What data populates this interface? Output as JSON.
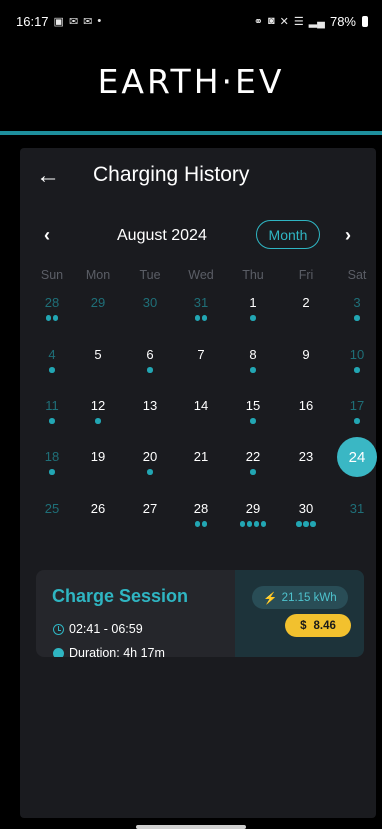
{
  "status_bar": {
    "time": "16:17",
    "notification_icons": [
      "image-icon",
      "mail-icon",
      "mail-icon"
    ],
    "battery": "78%"
  },
  "brand": {
    "name": "EARTH·EV",
    "accent_color": "#1aa7b3"
  },
  "header": {
    "title": "Charging History"
  },
  "calendar": {
    "month_label": "August 2024",
    "view_button": "Month",
    "weekdays": [
      "Sun",
      "Mon",
      "Tue",
      "Wed",
      "Thu",
      "Fri",
      "Sat"
    ],
    "weeks": [
      [
        {
          "d": "28",
          "o": true,
          "n": 2
        },
        {
          "d": "29",
          "o": true,
          "n": 0
        },
        {
          "d": "30",
          "o": true,
          "n": 0
        },
        {
          "d": "31",
          "o": true,
          "n": 2
        },
        {
          "d": "1",
          "o": false,
          "n": 1
        },
        {
          "d": "2",
          "o": false,
          "n": 0
        },
        {
          "d": "3",
          "o": true,
          "n": 1
        }
      ],
      [
        {
          "d": "4",
          "o": true,
          "n": 1
        },
        {
          "d": "5",
          "o": false,
          "n": 0
        },
        {
          "d": "6",
          "o": false,
          "n": 1
        },
        {
          "d": "7",
          "o": false,
          "n": 0
        },
        {
          "d": "8",
          "o": false,
          "n": 1
        },
        {
          "d": "9",
          "o": false,
          "n": 0
        },
        {
          "d": "10",
          "o": true,
          "n": 1
        }
      ],
      [
        {
          "d": "11",
          "o": true,
          "n": 1
        },
        {
          "d": "12",
          "o": false,
          "n": 1
        },
        {
          "d": "13",
          "o": false,
          "n": 0
        },
        {
          "d": "14",
          "o": false,
          "n": 0
        },
        {
          "d": "15",
          "o": false,
          "n": 1
        },
        {
          "d": "16",
          "o": false,
          "n": 0
        },
        {
          "d": "17",
          "o": true,
          "n": 1
        }
      ],
      [
        {
          "d": "18",
          "o": true,
          "n": 1
        },
        {
          "d": "19",
          "o": false,
          "n": 0
        },
        {
          "d": "20",
          "o": false,
          "n": 1
        },
        {
          "d": "21",
          "o": false,
          "n": 0
        },
        {
          "d": "22",
          "o": false,
          "n": 1
        },
        {
          "d": "23",
          "o": false,
          "n": 0
        },
        {
          "d": "24",
          "o": false,
          "n": 0,
          "selected": true
        }
      ],
      [
        {
          "d": "25",
          "o": true,
          "n": 0
        },
        {
          "d": "26",
          "o": false,
          "n": 0
        },
        {
          "d": "27",
          "o": false,
          "n": 0
        },
        {
          "d": "28",
          "o": false,
          "n": 2
        },
        {
          "d": "29",
          "o": false,
          "n": 4
        },
        {
          "d": "30",
          "o": false,
          "n": 3
        },
        {
          "d": "31",
          "o": true,
          "n": 0
        }
      ]
    ],
    "selected_day": "24"
  },
  "session": {
    "title": "Charge Session",
    "time_range": "02:41 - 06:59",
    "duration": "Duration: 4h 17m",
    "energy": "21.15 kWh",
    "cost_symbol": "$",
    "cost": "8.46"
  },
  "colors": {
    "accent": "#2fb5c2",
    "dot": "#22a6b3",
    "weekend_day": "#1f6f78",
    "panel": "#1a1b1f",
    "cost_pill": "#f2c12e"
  }
}
